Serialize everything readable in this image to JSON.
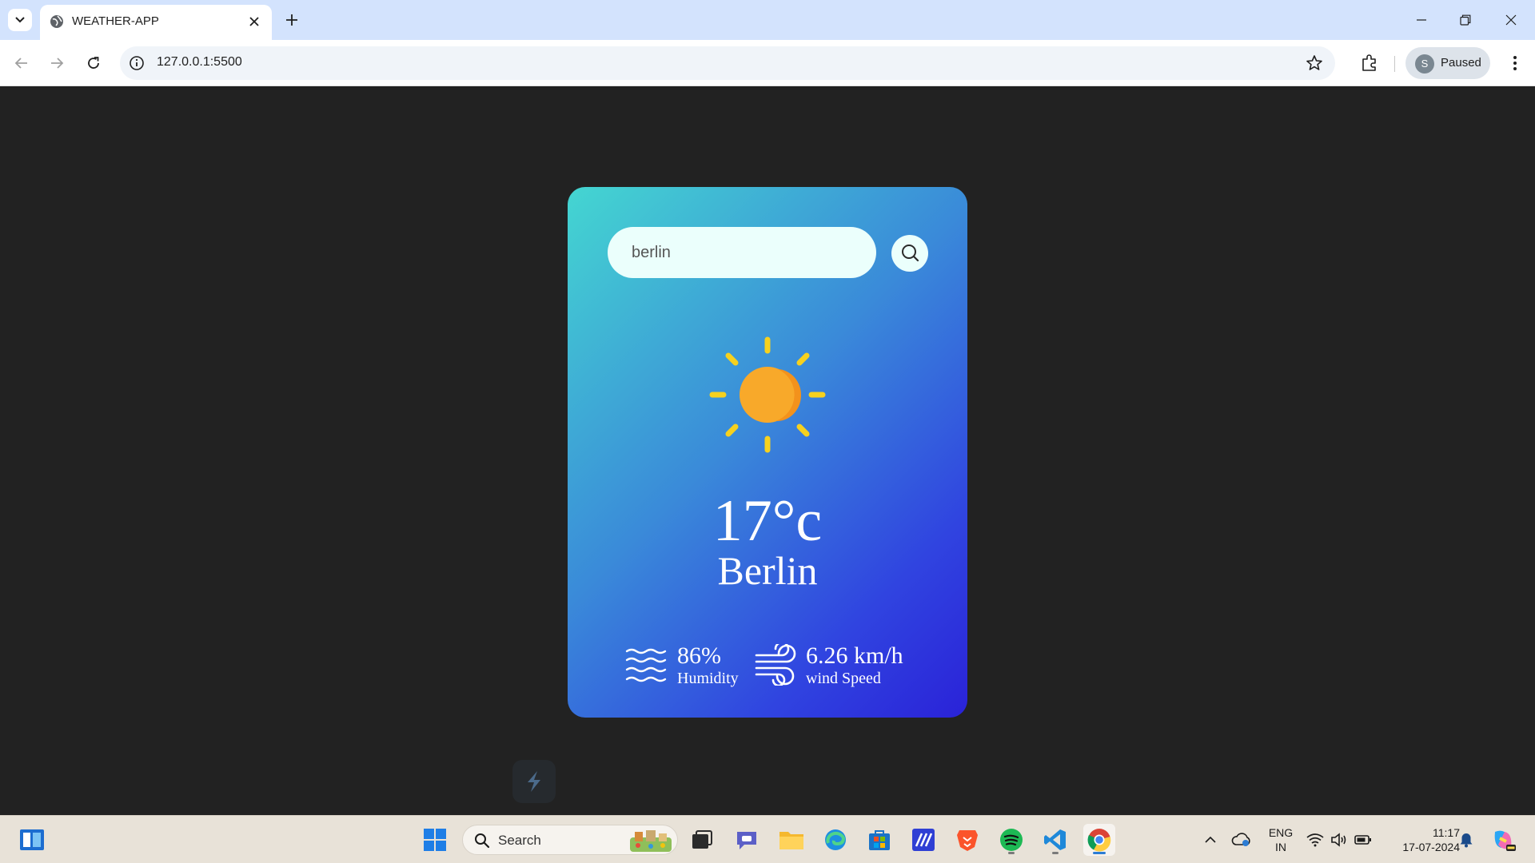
{
  "browser": {
    "tab_title": "WEATHER-APP",
    "url": "127.0.0.1:5500",
    "profile_initial": "S",
    "profile_status": "Paused"
  },
  "app": {
    "search_value": "berlin",
    "weather_icon": "sun-icon",
    "temperature": "17°c",
    "city": "Berlin",
    "humidity_value": "86%",
    "humidity_label": "Humidity",
    "wind_value": "6.26 km/h",
    "wind_label": "wind Speed",
    "colors": {
      "card_top": "#44d6d1",
      "card_bottom": "#2a22d8",
      "sun": "#f8a92a",
      "rays": "#f6d11e"
    }
  },
  "taskbar": {
    "search_label": "Search",
    "lang_top": "ENG",
    "lang_bottom": "IN",
    "time": "11:17",
    "date": "17-07-2024"
  }
}
